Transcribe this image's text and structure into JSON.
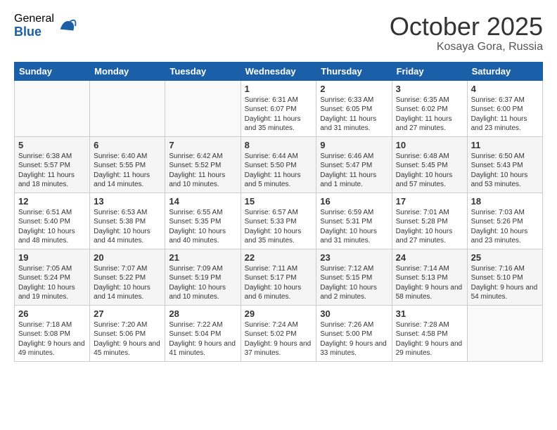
{
  "header": {
    "logo_general": "General",
    "logo_blue": "Blue",
    "month": "October 2025",
    "location": "Kosaya Gora, Russia"
  },
  "weekdays": [
    "Sunday",
    "Monday",
    "Tuesday",
    "Wednesday",
    "Thursday",
    "Friday",
    "Saturday"
  ],
  "weeks": [
    [
      {
        "day": "",
        "info": ""
      },
      {
        "day": "",
        "info": ""
      },
      {
        "day": "",
        "info": ""
      },
      {
        "day": "1",
        "info": "Sunrise: 6:31 AM\nSunset: 6:07 PM\nDaylight: 11 hours\nand 35 minutes."
      },
      {
        "day": "2",
        "info": "Sunrise: 6:33 AM\nSunset: 6:05 PM\nDaylight: 11 hours\nand 31 minutes."
      },
      {
        "day": "3",
        "info": "Sunrise: 6:35 AM\nSunset: 6:02 PM\nDaylight: 11 hours\nand 27 minutes."
      },
      {
        "day": "4",
        "info": "Sunrise: 6:37 AM\nSunset: 6:00 PM\nDaylight: 11 hours\nand 23 minutes."
      }
    ],
    [
      {
        "day": "5",
        "info": "Sunrise: 6:38 AM\nSunset: 5:57 PM\nDaylight: 11 hours\nand 18 minutes."
      },
      {
        "day": "6",
        "info": "Sunrise: 6:40 AM\nSunset: 5:55 PM\nDaylight: 11 hours\nand 14 minutes."
      },
      {
        "day": "7",
        "info": "Sunrise: 6:42 AM\nSunset: 5:52 PM\nDaylight: 11 hours\nand 10 minutes."
      },
      {
        "day": "8",
        "info": "Sunrise: 6:44 AM\nSunset: 5:50 PM\nDaylight: 11 hours\nand 5 minutes."
      },
      {
        "day": "9",
        "info": "Sunrise: 6:46 AM\nSunset: 5:47 PM\nDaylight: 11 hours\nand 1 minute."
      },
      {
        "day": "10",
        "info": "Sunrise: 6:48 AM\nSunset: 5:45 PM\nDaylight: 10 hours\nand 57 minutes."
      },
      {
        "day": "11",
        "info": "Sunrise: 6:50 AM\nSunset: 5:43 PM\nDaylight: 10 hours\nand 53 minutes."
      }
    ],
    [
      {
        "day": "12",
        "info": "Sunrise: 6:51 AM\nSunset: 5:40 PM\nDaylight: 10 hours\nand 48 minutes."
      },
      {
        "day": "13",
        "info": "Sunrise: 6:53 AM\nSunset: 5:38 PM\nDaylight: 10 hours\nand 44 minutes."
      },
      {
        "day": "14",
        "info": "Sunrise: 6:55 AM\nSunset: 5:35 PM\nDaylight: 10 hours\nand 40 minutes."
      },
      {
        "day": "15",
        "info": "Sunrise: 6:57 AM\nSunset: 5:33 PM\nDaylight: 10 hours\nand 35 minutes."
      },
      {
        "day": "16",
        "info": "Sunrise: 6:59 AM\nSunset: 5:31 PM\nDaylight: 10 hours\nand 31 minutes."
      },
      {
        "day": "17",
        "info": "Sunrise: 7:01 AM\nSunset: 5:28 PM\nDaylight: 10 hours\nand 27 minutes."
      },
      {
        "day": "18",
        "info": "Sunrise: 7:03 AM\nSunset: 5:26 PM\nDaylight: 10 hours\nand 23 minutes."
      }
    ],
    [
      {
        "day": "19",
        "info": "Sunrise: 7:05 AM\nSunset: 5:24 PM\nDaylight: 10 hours\nand 19 minutes."
      },
      {
        "day": "20",
        "info": "Sunrise: 7:07 AM\nSunset: 5:22 PM\nDaylight: 10 hours\nand 14 minutes."
      },
      {
        "day": "21",
        "info": "Sunrise: 7:09 AM\nSunset: 5:19 PM\nDaylight: 10 hours\nand 10 minutes."
      },
      {
        "day": "22",
        "info": "Sunrise: 7:11 AM\nSunset: 5:17 PM\nDaylight: 10 hours\nand 6 minutes."
      },
      {
        "day": "23",
        "info": "Sunrise: 7:12 AM\nSunset: 5:15 PM\nDaylight: 10 hours\nand 2 minutes."
      },
      {
        "day": "24",
        "info": "Sunrise: 7:14 AM\nSunset: 5:13 PM\nDaylight: 9 hours\nand 58 minutes."
      },
      {
        "day": "25",
        "info": "Sunrise: 7:16 AM\nSunset: 5:10 PM\nDaylight: 9 hours\nand 54 minutes."
      }
    ],
    [
      {
        "day": "26",
        "info": "Sunrise: 7:18 AM\nSunset: 5:08 PM\nDaylight: 9 hours\nand 49 minutes."
      },
      {
        "day": "27",
        "info": "Sunrise: 7:20 AM\nSunset: 5:06 PM\nDaylight: 9 hours\nand 45 minutes."
      },
      {
        "day": "28",
        "info": "Sunrise: 7:22 AM\nSunset: 5:04 PM\nDaylight: 9 hours\nand 41 minutes."
      },
      {
        "day": "29",
        "info": "Sunrise: 7:24 AM\nSunset: 5:02 PM\nDaylight: 9 hours\nand 37 minutes."
      },
      {
        "day": "30",
        "info": "Sunrise: 7:26 AM\nSunset: 5:00 PM\nDaylight: 9 hours\nand 33 minutes."
      },
      {
        "day": "31",
        "info": "Sunrise: 7:28 AM\nSunset: 4:58 PM\nDaylight: 9 hours\nand 29 minutes."
      },
      {
        "day": "",
        "info": ""
      }
    ]
  ]
}
